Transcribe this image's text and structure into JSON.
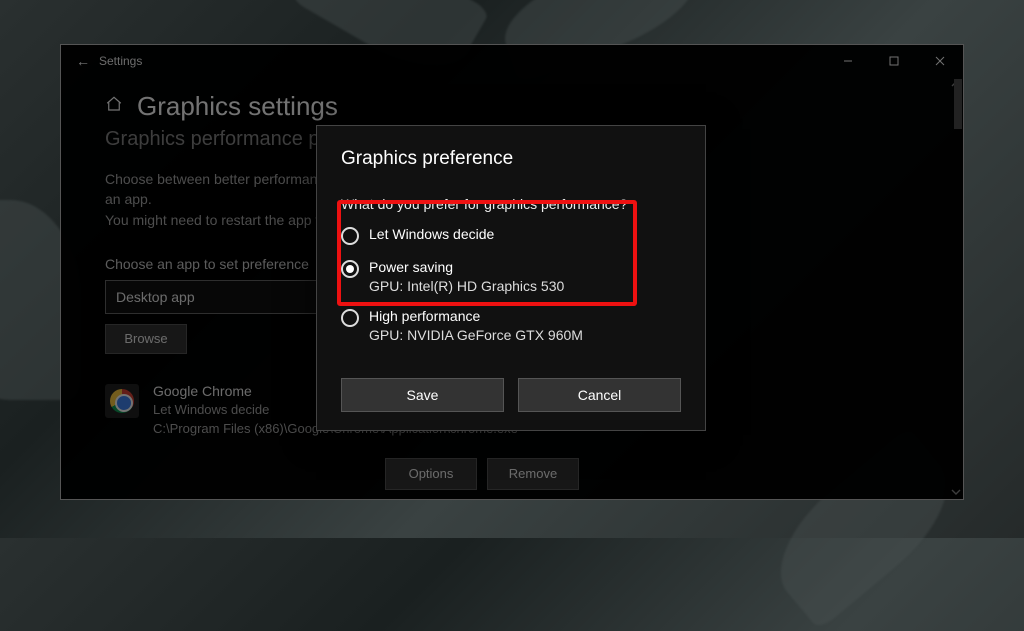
{
  "window": {
    "back_glyph": "←",
    "title": "Settings"
  },
  "page": {
    "title": "Graphics settings",
    "subheading": "Graphics performance preference",
    "description_line1": "Choose between better performance or longer battery life when using an app.",
    "description_line2": "You might need to restart the app for your changes to take effect.",
    "choose_label": "Choose an app to set preference",
    "dropdown_value": "Desktop app",
    "browse_label": "Browse"
  },
  "apps": [
    {
      "name": "Google Chrome",
      "pref": "Let Windows decide",
      "path": "C:\\Program Files (x86)\\Google\\Chrome\\Application\\chrome.exe"
    }
  ],
  "app_actions": {
    "options": "Options",
    "remove": "Remove"
  },
  "dialog": {
    "title": "Graphics preference",
    "question": "What do you prefer for graphics performance?",
    "options": [
      {
        "label": "Let Windows decide",
        "gpu": "",
        "selected": false
      },
      {
        "label": "Power saving",
        "gpu": "GPU: Intel(R) HD Graphics 530",
        "selected": true
      },
      {
        "label": "High performance",
        "gpu": "GPU: NVIDIA GeForce GTX 960M",
        "selected": false
      }
    ],
    "save": "Save",
    "cancel": "Cancel"
  }
}
